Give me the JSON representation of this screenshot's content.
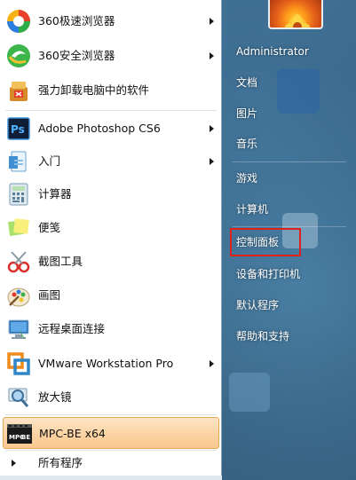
{
  "start_menu": {
    "programs": [
      {
        "label": "360极速浏览器",
        "icon": "360-speed-browser-icon",
        "has_submenu": true
      },
      {
        "label": "360安全浏览器",
        "icon": "360-safe-browser-icon",
        "has_submenu": true
      },
      {
        "label": "强力卸载电脑中的软件",
        "icon": "uninstaller-icon",
        "has_submenu": false
      },
      {
        "label": "Adobe Photoshop CS6",
        "icon": "photoshop-icon",
        "has_submenu": true
      },
      {
        "label": "入门",
        "icon": "getting-started-icon",
        "has_submenu": true
      },
      {
        "label": "计算器",
        "icon": "calculator-icon",
        "has_submenu": false
      },
      {
        "label": "便笺",
        "icon": "sticky-notes-icon",
        "has_submenu": false
      },
      {
        "label": "截图工具",
        "icon": "snipping-tool-icon",
        "has_submenu": false
      },
      {
        "label": "画图",
        "icon": "paint-icon",
        "has_submenu": false
      },
      {
        "label": "远程桌面连接",
        "icon": "remote-desktop-icon",
        "has_submenu": false
      },
      {
        "label": "VMware Workstation Pro",
        "icon": "vmware-icon",
        "has_submenu": true
      },
      {
        "label": "放大镜",
        "icon": "magnifier-icon",
        "has_submenu": false
      },
      {
        "label": "MPC-BE x64",
        "icon": "mpc-be-icon",
        "has_submenu": false,
        "highlighted": true
      }
    ],
    "all_programs_label": "所有程序",
    "right": {
      "user": "Administrator",
      "documents": "文档",
      "pictures": "图片",
      "music": "音乐",
      "games": "游戏",
      "computer": "计算机",
      "control_panel": "控制面板",
      "devices_printers": "设备和打印机",
      "default_programs": "默认程序",
      "help_support": "帮助和支持"
    },
    "highlight_color": "#e0201a"
  }
}
